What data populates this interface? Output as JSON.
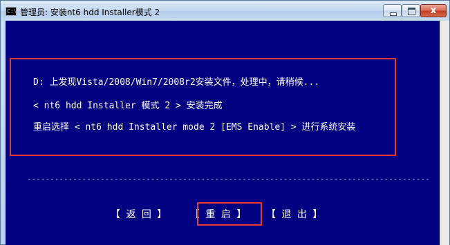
{
  "window": {
    "title": "管理员:  安装nt6 hdd Installer模式 2",
    "app_icon_text": "C:\\",
    "close_glyph": "x"
  },
  "console": {
    "lines": [
      "D: 上发现Vista/2008/Win7/2008r2安装文件，处理中，请稍候...",
      "< nt6 hdd Installer 模式 2 > 安装完成",
      "重启选择 < nt6 hdd Installer mode 2 [EMS Enable] > 进行系统安装"
    ],
    "separator": "------------------------------------------------------------------------------------------------------------------------------------------------------------"
  },
  "menu": {
    "back": "【 返 回 】",
    "restart": "【 重 启 】",
    "exit": "【 退 出 】"
  },
  "colors": {
    "console_bg": "#000080",
    "console_text": "#ffffff",
    "highlight_border": "#e53935"
  }
}
